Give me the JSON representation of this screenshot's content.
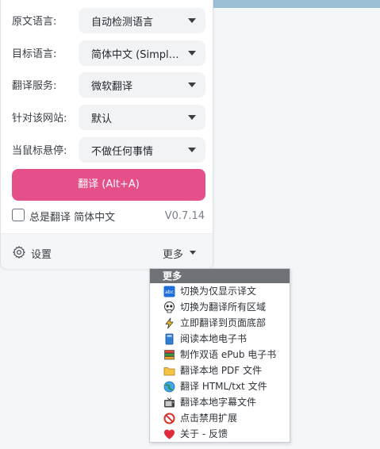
{
  "form": {
    "source_lang": {
      "label": "原文语言:",
      "value": "自动检测语言"
    },
    "target_lang": {
      "label": "目标语言:",
      "value": "简体中文 (Simplified Chinese)"
    },
    "service": {
      "label": "翻译服务:",
      "value": "微软翻译"
    },
    "site": {
      "label": "针对该网站:",
      "value": "默认"
    },
    "hover": {
      "label": "当鼠标悬停:",
      "value": "不做任何事情"
    }
  },
  "translate_button": "翻译 (Alt+A)",
  "always_translate": "总是翻译 简体中文",
  "version": "V0.7.14",
  "footer": {
    "settings": "设置",
    "more": "更多"
  },
  "menu": {
    "header": "更多",
    "items": [
      {
        "label": "切换为仅显示译文",
        "icon": "translate-only-icon"
      },
      {
        "label": "切换为翻译所有区域",
        "icon": "skull-icon"
      },
      {
        "label": "立即翻译到页面底部",
        "icon": "lightning-icon"
      },
      {
        "label": "阅读本地电子书",
        "icon": "book-icon"
      },
      {
        "label": "制作双语 ePub 电子书",
        "icon": "books-icon"
      },
      {
        "label": "翻译本地 PDF 文件",
        "icon": "folder-icon"
      },
      {
        "label": "翻译 HTML/txt 文件",
        "icon": "globe-icon"
      },
      {
        "label": "翻译本地字幕文件",
        "icon": "tv-icon"
      },
      {
        "label": "点击禁用扩展",
        "icon": "prohibited-icon"
      },
      {
        "label": "关于 - 反馈",
        "icon": "heart-icon"
      }
    ]
  },
  "colors": {
    "accent": "#e5508a",
    "menu_header": "#6f7378",
    "topbar": "#9dbfd6"
  }
}
